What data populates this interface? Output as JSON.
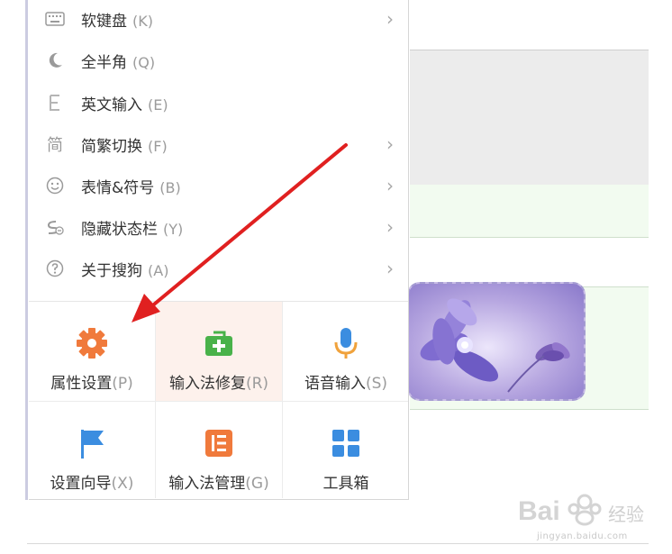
{
  "menu": {
    "items": [
      {
        "label": "软键盘",
        "key": "(K)",
        "icon": "keyboard-icon",
        "has_arrow": true
      },
      {
        "label": "全半角",
        "key": "(Q)",
        "icon": "moon-icon",
        "has_arrow": false
      },
      {
        "label": "英文输入",
        "key": "(E)",
        "icon": "letter-e-icon",
        "has_arrow": false
      },
      {
        "label": "简繁切换",
        "key": "(F)",
        "icon": "traditional-char-icon",
        "icon_text": "简",
        "has_arrow": true
      },
      {
        "label": "表情&符号",
        "key": "(B)",
        "icon": "smiley-icon",
        "has_arrow": true
      },
      {
        "label": "隐藏状态栏",
        "key": "(Y)",
        "icon": "hide-statusbar-icon",
        "has_arrow": true
      },
      {
        "label": "关于搜狗",
        "key": "(A)",
        "icon": "question-icon",
        "has_arrow": true
      }
    ],
    "arrow_glyph": "›"
  },
  "grid": [
    {
      "label": "属性设置",
      "key": "(P)",
      "icon": "gear-icon",
      "color": "#f07a3c"
    },
    {
      "label": "输入法修复",
      "key": "(R)",
      "icon": "repair-toolbox-icon",
      "color": "#49b24a",
      "highlighted": true
    },
    {
      "label": "语音输入",
      "key": "(S)",
      "icon": "microphone-icon",
      "color": "#3b8de0"
    },
    {
      "label": "设置向导",
      "key": "(X)",
      "icon": "flag-icon",
      "color": "#3b8de0"
    },
    {
      "label": "输入法管理",
      "key": "(G)",
      "icon": "manager-icon",
      "color": "#f07a3c"
    },
    {
      "label": "工具箱",
      "key": "",
      "icon": "toolbox-grid-icon",
      "color": "#3b8de0"
    }
  ],
  "annotation": {
    "arrow_color": "#e02020"
  },
  "watermark": {
    "text": "经验",
    "url": "jingyan.baidu.com"
  }
}
